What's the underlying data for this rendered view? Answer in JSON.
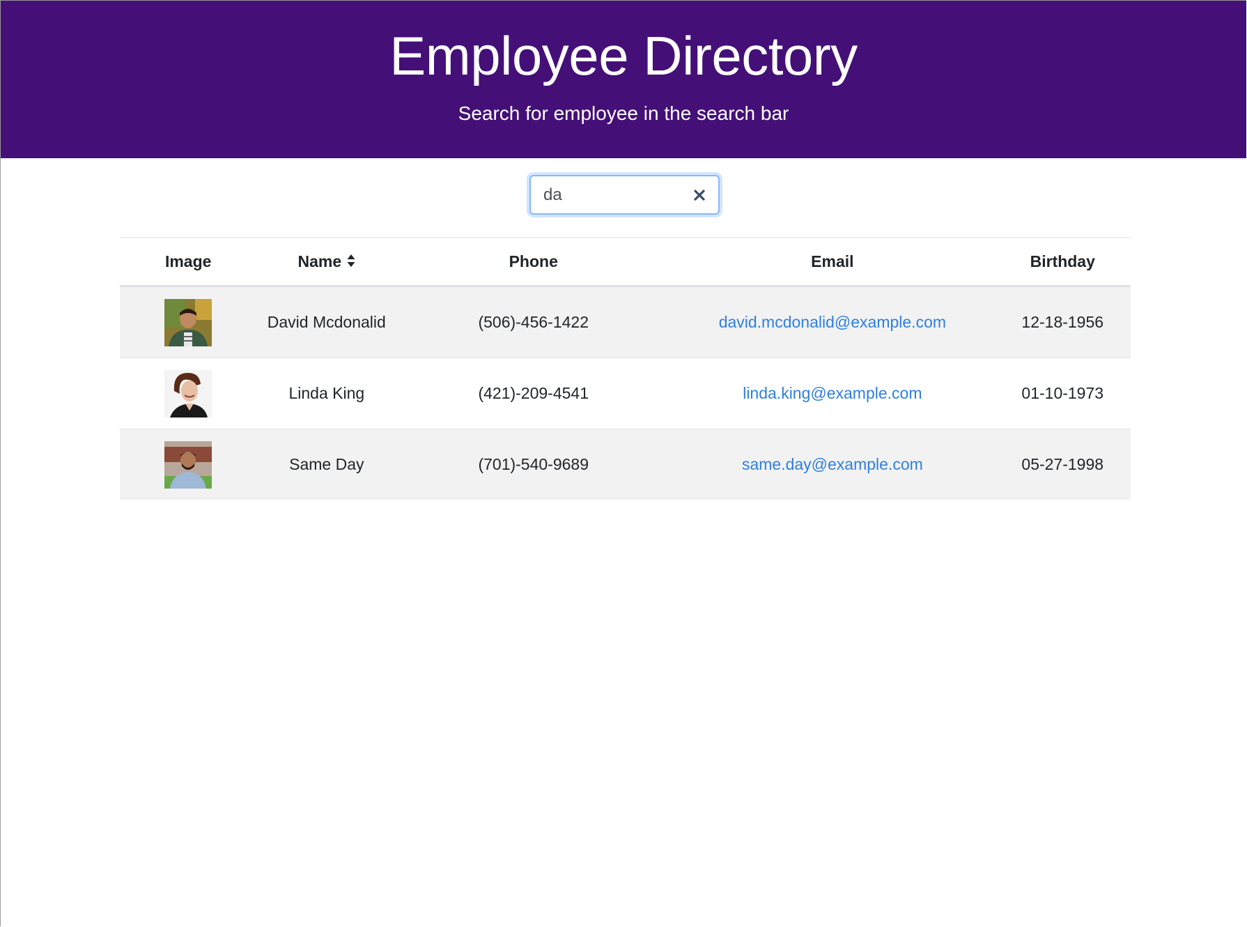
{
  "header": {
    "title": "Employee Directory",
    "subtitle": "Search for employee in the search bar",
    "background_color": "#441078"
  },
  "search": {
    "value": "da"
  },
  "table": {
    "columns": {
      "image": "Image",
      "name": "Name",
      "phone": "Phone",
      "email": "Email",
      "birthday": "Birthday"
    },
    "rows": [
      {
        "name": "David Mcdonalid",
        "phone": "(506)-456-1422",
        "email": "david.mcdonalid@example.com",
        "birthday": "12-18-1956",
        "avatar_icon": "man-portrait-outdoors"
      },
      {
        "name": "Linda King",
        "phone": "(421)-209-4541",
        "email": "linda.king@example.com",
        "birthday": "01-10-1973",
        "avatar_icon": "woman-portrait"
      },
      {
        "name": "Same Day",
        "phone": "(701)-540-9689",
        "email": "same.day@example.com",
        "birthday": "05-27-1998",
        "avatar_icon": "man-portrait-street"
      }
    ]
  },
  "colors": {
    "link": "#2f7fe0",
    "stripe": "#f2f2f2",
    "focus_ring": "#86b7fe"
  }
}
